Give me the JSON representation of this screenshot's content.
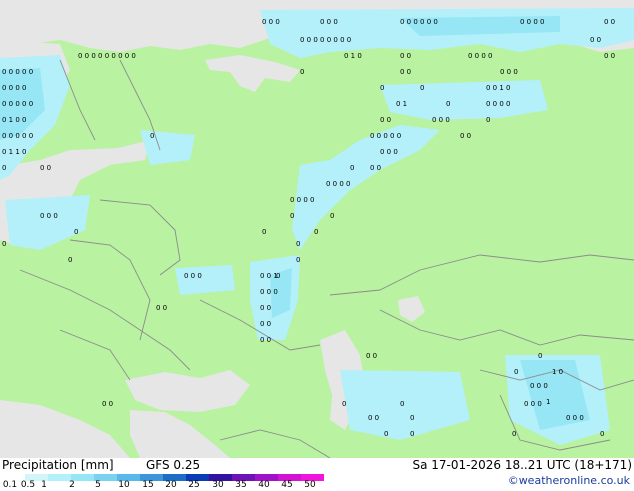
{
  "map": {
    "colors": {
      "land": "#b9f2a1",
      "sea": "#e6e6e6",
      "rain_light": "#b4f0fa",
      "rain_medium": "#96e6f5",
      "border": "#8c8c8c",
      "marker": "#000000"
    }
  },
  "legend": {
    "title": "Precipitation [mm]",
    "product": "GFS 0.25",
    "datetime": "Sa 17-01-2026 18..21 UTC (18+171)",
    "credit": "©weatheronline.co.uk",
    "scale_labels": [
      "0.1",
      "0.5",
      "1",
      "2",
      "5",
      "10",
      "15",
      "20",
      "25",
      "30",
      "35",
      "40",
      "45",
      "50"
    ],
    "scale_colors": [
      "#ffffff",
      "#d2f5fa",
      "#b4f0fa",
      "#96e6f5",
      "#78d2f0",
      "#5ab9eb",
      "#3c96dc",
      "#1e6ec8",
      "#0a3cb4",
      "#3214a0",
      "#6e14b4",
      "#a014c8",
      "#d214d2",
      "#f014dc"
    ]
  }
}
